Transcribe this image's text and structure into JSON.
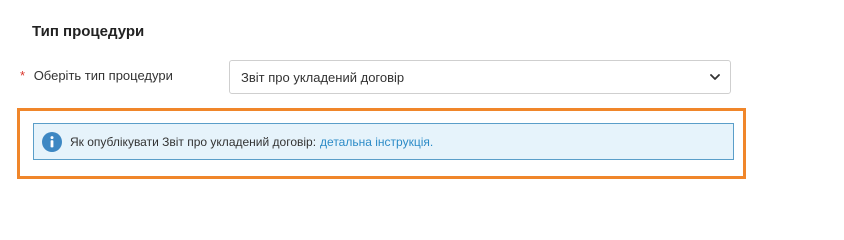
{
  "section": {
    "title": "Тип процедури"
  },
  "procedure_field": {
    "required_mark": "*",
    "label": "Оберіть тип процедури",
    "selected_value": "Звіт про укладений договір",
    "dropdown_icon": "chevron-down-icon"
  },
  "info_notice": {
    "icon": "info-icon",
    "text": "Як опублікувати Звіт про укладений договір:",
    "link_text": "детальна інструкція."
  },
  "colors": {
    "highlight_border": "#f0862a",
    "info_background": "#e6f3fb",
    "info_border": "#5a9ec9",
    "link": "#2c8bc7",
    "required": "#d9342b"
  }
}
